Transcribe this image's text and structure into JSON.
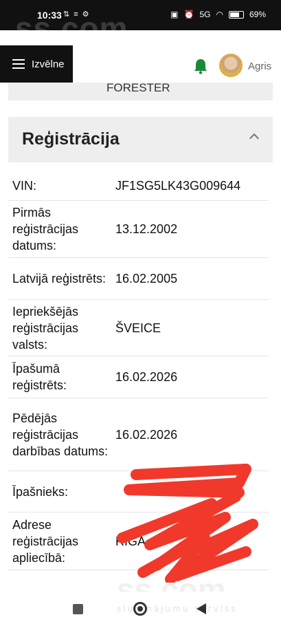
{
  "status_bar": {
    "time": "10:33",
    "network_label": "5G",
    "battery": "69%"
  },
  "watermark": {
    "brand": "ss.com",
    "tagline": "sludinājumu serviss"
  },
  "header": {
    "menu_label": "Izvēlne",
    "username": "Agris"
  },
  "previous_card": {
    "visible_text": "FORESTER"
  },
  "section": {
    "title": "Reģistrācija",
    "rows": [
      {
        "label": "VIN:",
        "value": "JF1SG5LK43G009644"
      },
      {
        "label": "Pirmās reģistrācijas datums:",
        "value": "13.12.2002"
      },
      {
        "label": "Latvijā reģistrēts:",
        "value": "16.02.2005"
      },
      {
        "label": "Iepriekšējās reģistrācijas valsts:",
        "value": "ŠVEICE"
      },
      {
        "label": "Īpašumā reģistrēts:",
        "value": "16.02.2026"
      },
      {
        "label": "Pēdējās reģistrācijas darbības datums:",
        "value": "16.02.2026"
      },
      {
        "label": "Īpašnieks:",
        "value": ""
      },
      {
        "label": "Adrese reģistrācijas apliecībā:",
        "value": "RĪGA"
      }
    ]
  },
  "colors": {
    "accent_green": "#1a8a3a",
    "redaction": "#f0392b"
  },
  "icons": [
    "bell-icon",
    "chevron-up-icon",
    "hamburger-icon"
  ]
}
